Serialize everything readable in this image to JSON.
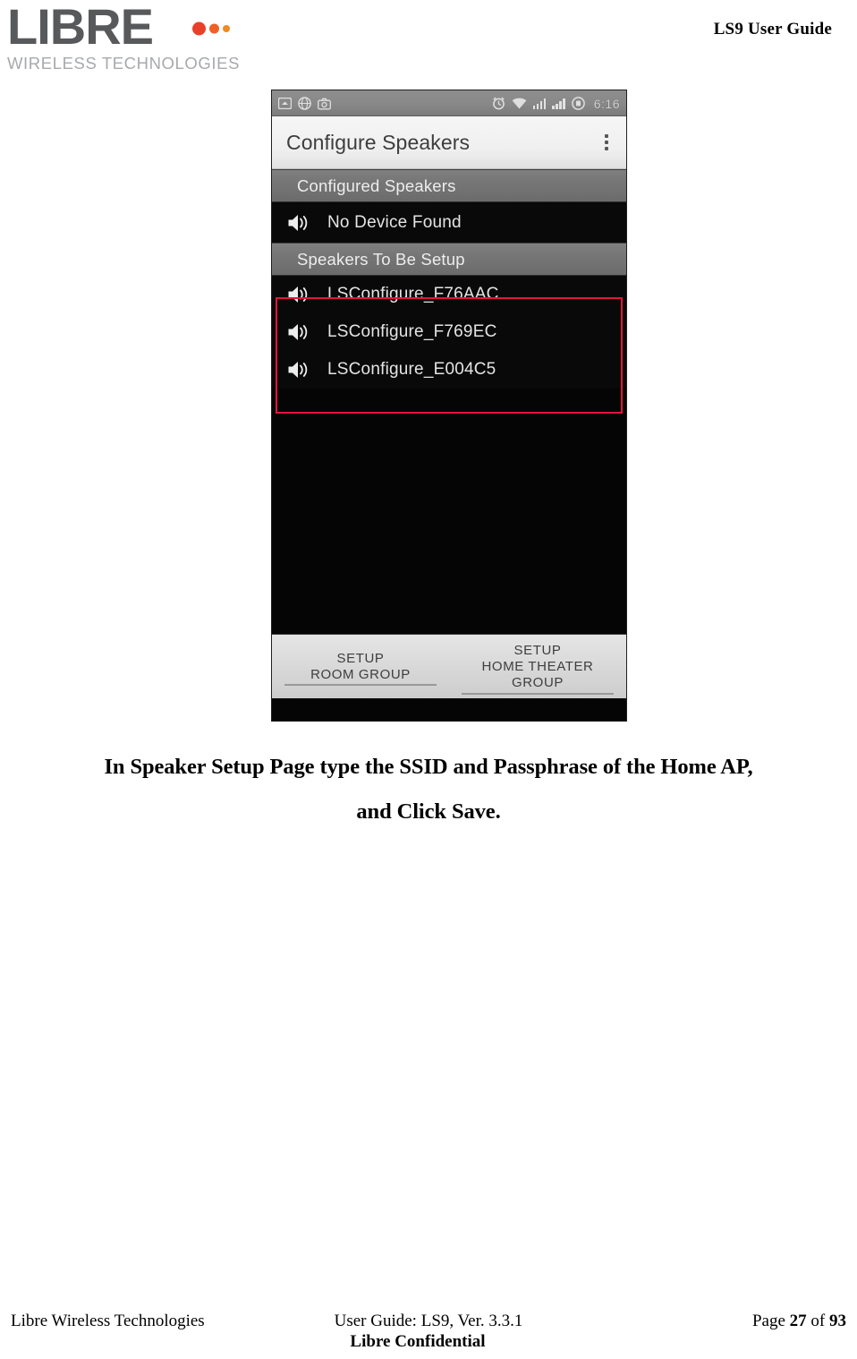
{
  "header": {
    "logo_word": "LIBRE",
    "logo_tagline": "WIRELESS TECHNOLOGIES",
    "doc_title": "LS9 User Guide",
    "brand_colors": {
      "wordmark": "#58595b",
      "dot_1": "#e8402a",
      "dot_2": "#ef6024",
      "dot_3": "#f08a22",
      "tagline": "#a7a9ac"
    }
  },
  "phone": {
    "status_bar": {
      "left_icons": [
        "screenshot-icon",
        "browser-icon",
        "camera-icon"
      ],
      "right_icons": [
        "alarm-clock-icon",
        "wifi-icon",
        "signal-bars-icon",
        "signal-bars-icon",
        "battery-icon"
      ],
      "time": "6:16"
    },
    "action_bar": {
      "title": "Configure Speakers",
      "overflow_label": "overflow-menu"
    },
    "sections": [
      {
        "header": "Configured Speakers",
        "rows": [
          {
            "icon": "speaker-icon",
            "label": "No Device Found"
          }
        ]
      },
      {
        "header": "Speakers To Be Setup",
        "highlighted": true,
        "highlight_color": "#e8103a",
        "rows": [
          {
            "icon": "speaker-icon",
            "label": "LSConfigure_F76AAC"
          },
          {
            "icon": "speaker-icon",
            "label": "LSConfigure_F769EC"
          },
          {
            "icon": "speaker-icon",
            "label": "LSConfigure_E004C5"
          }
        ]
      }
    ],
    "tab_bar": [
      {
        "line1": "SETUP",
        "line2": "ROOM GROUP"
      },
      {
        "line1": "SETUP",
        "line2": "HOME THEATER",
        "line3": "GROUP"
      }
    ]
  },
  "caption": {
    "line1": "In Speaker Setup Page type the SSID and Passphrase of the Home AP,",
    "line2": "and Click Save."
  },
  "footer": {
    "left": "Libre Wireless Technologies",
    "center": "User Guide: LS9, Ver. 3.3.1",
    "page_prefix": "Page ",
    "page_number": "27",
    "page_of": " of ",
    "page_total": "93",
    "confidential": "Libre Confidential"
  }
}
